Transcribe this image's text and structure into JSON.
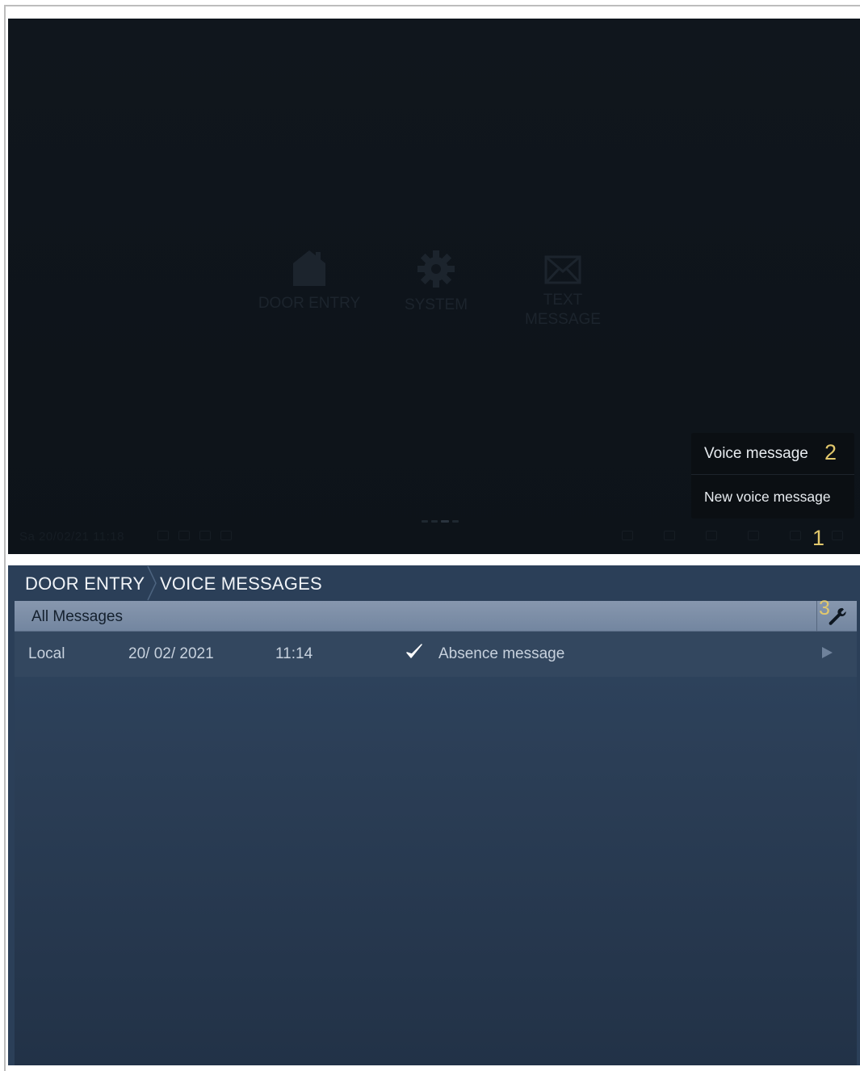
{
  "top_screen": {
    "home_items": [
      {
        "label": "DOOR ENTRY",
        "icon": "house-icon"
      },
      {
        "label": "SYSTEM",
        "icon": "gear-icon"
      },
      {
        "label": "TEXT\nMESSAGE",
        "icon": "envelope-icon"
      }
    ],
    "status_bar": {
      "date_time": "Sa 20/02/21   11:18"
    },
    "popup": {
      "items": [
        {
          "label": "Voice message"
        },
        {
          "label": "New voice message"
        }
      ]
    }
  },
  "callouts": {
    "one": "1",
    "two": "2",
    "three": "3"
  },
  "bottom_screen": {
    "breadcrumb": [
      "DOOR ENTRY",
      "VOICE MESSAGES"
    ],
    "filter_label": "All Messages",
    "settings_icon": "wrench-icon",
    "messages": [
      {
        "source": "Local",
        "date": "20/ 02/ 2021",
        "time": "11:14",
        "checked": "✓",
        "text": "Absence message"
      }
    ]
  },
  "colors": {
    "callout": "#e2c86c",
    "top_background": "#0f151c",
    "bottom_background": "#2b3f58",
    "filter_bar": "#7f91a9"
  }
}
